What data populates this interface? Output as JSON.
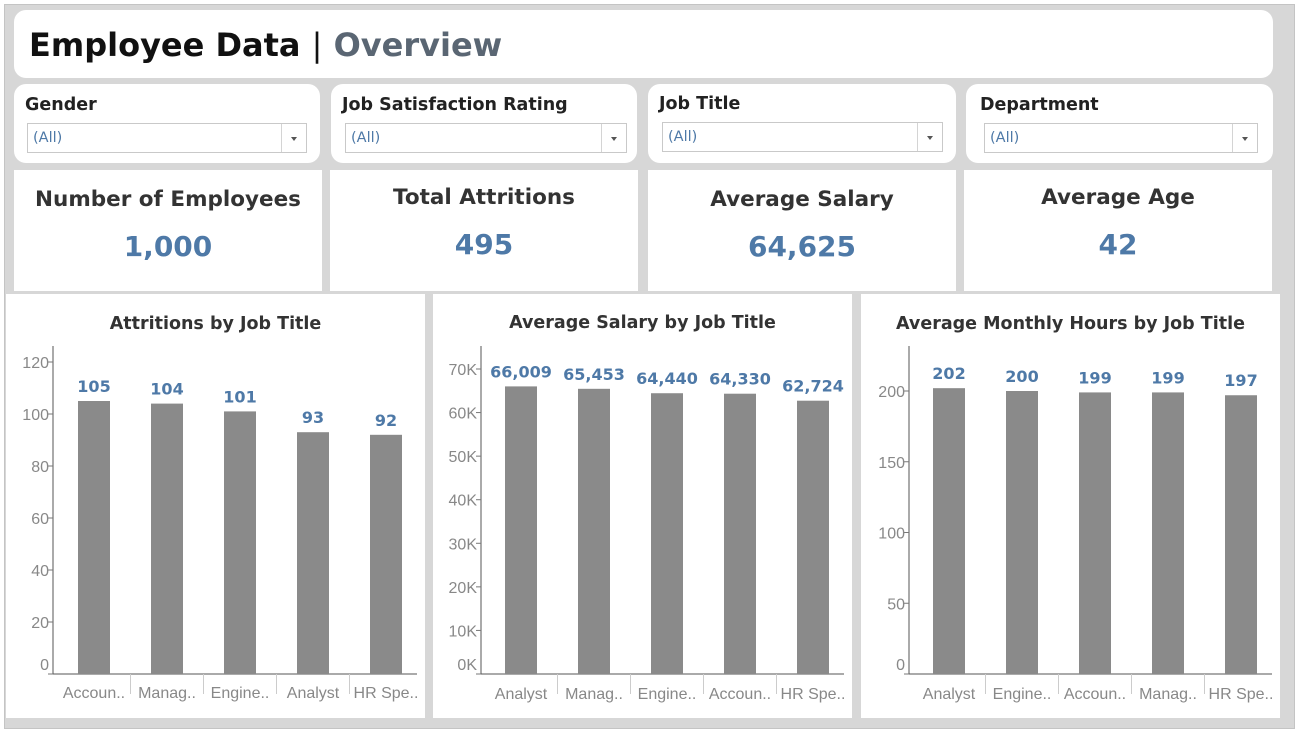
{
  "header": {
    "title": "Employee Data",
    "separator": "|",
    "subtitle": "Overview"
  },
  "filters": [
    {
      "label": "Gender",
      "value": "(All)"
    },
    {
      "label": "Job Satisfaction Rating",
      "value": "(All)"
    },
    {
      "label": "Job Title",
      "value": "(All)"
    },
    {
      "label": "Department",
      "value": "(All)"
    }
  ],
  "kpis": [
    {
      "label": "Number of Employees",
      "value": "1,000"
    },
    {
      "label": "Total Attritions",
      "value": "495"
    },
    {
      "label": "Average Salary",
      "value": "64,625"
    },
    {
      "label": "Average Age",
      "value": "42"
    }
  ],
  "colors": {
    "bar": "#8a8a8a",
    "label": "#4e79a7",
    "background": "#d7d7d7"
  },
  "chart_data": [
    {
      "type": "bar",
      "title": "Attritions by Job Title",
      "categories": [
        "Accoun..",
        "Manag..",
        "Engine..",
        "Analyst",
        "HR Spe.."
      ],
      "values": [
        105,
        104,
        101,
        93,
        92
      ],
      "data_labels": [
        "105",
        "104",
        "101",
        "93",
        "92"
      ],
      "ylim": [
        0,
        120
      ],
      "yticks": [
        0,
        20,
        40,
        60,
        80,
        100,
        120
      ],
      "ytick_labels": [
        "0",
        "20",
        "40",
        "60",
        "80",
        "100",
        "120"
      ],
      "grid": false
    },
    {
      "type": "bar",
      "title": "Average Salary by Job Title",
      "categories": [
        "Analyst",
        "Manag..",
        "Engine..",
        "Accoun..",
        "HR Spe.."
      ],
      "values": [
        66009,
        65453,
        64440,
        64330,
        62724
      ],
      "data_labels": [
        "66,009",
        "65,453",
        "64,440",
        "64,330",
        "62,724"
      ],
      "ylim": [
        0,
        70000
      ],
      "yticks": [
        0,
        10000,
        20000,
        30000,
        40000,
        50000,
        60000,
        70000
      ],
      "ytick_labels": [
        "0K",
        "10K",
        "20K",
        "30K",
        "40K",
        "50K",
        "60K",
        "70K"
      ],
      "grid": false
    },
    {
      "type": "bar",
      "title": "Average Monthly Hours by Job Title",
      "categories": [
        "Analyst",
        "Engine..",
        "Accoun..",
        "Manag..",
        "HR Spe.."
      ],
      "values": [
        202,
        200,
        199,
        199,
        197
      ],
      "data_labels": [
        "202",
        "200",
        "199",
        "199",
        "197"
      ],
      "ylim": [
        0,
        200
      ],
      "yticks": [
        0,
        50,
        100,
        150,
        200
      ],
      "ytick_labels": [
        "0",
        "50",
        "100",
        "150",
        "200"
      ],
      "grid": false
    }
  ]
}
